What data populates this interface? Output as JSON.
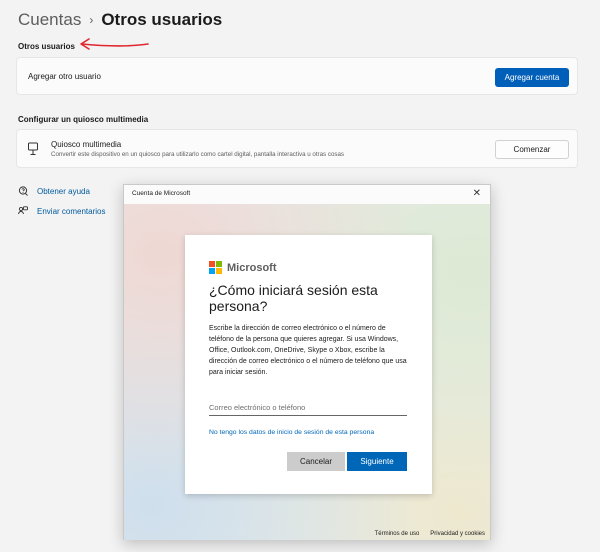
{
  "breadcrumb": {
    "parent": "Cuentas",
    "separator": "›",
    "current": "Otros usuarios"
  },
  "other_users": {
    "section_title": "Otros usuarios",
    "add_label": "Agregar otro usuario",
    "add_button": "Agregar cuenta"
  },
  "kiosk": {
    "section_title": "Configurar un quiosco multimedia",
    "title": "Quiosco multimedia",
    "description": "Convertir este dispositivo en un quiosco para utilizarlo como cartel digital, pantalla interactiva u otras cosas",
    "button": "Comenzar"
  },
  "help_links": [
    {
      "label": "Obtener ayuda",
      "icon": "help-icon"
    },
    {
      "label": "Enviar comentarios",
      "icon": "feedback-icon"
    }
  ],
  "dialog": {
    "title": "Cuenta de Microsoft",
    "close_glyph": "✕",
    "brand": "Microsoft",
    "brand_colors": [
      "#f25022",
      "#7fba00",
      "#00a4ef",
      "#ffb900"
    ],
    "heading": "¿Cómo iniciará sesión esta persona?",
    "description": "Escribe la dirección de correo electrónico o el número de teléfono de la persona que quieres agregar. Si usa Windows, Office, Outlook.com, OneDrive, Skype o Xbox, escribe la dirección de correo electrónico o el número de teléfono que usa para iniciar sesión.",
    "input_placeholder": "Correo electrónico o teléfono",
    "input_value": "",
    "no_data_link": "No tengo los datos de inicio de sesión de esta persona",
    "cancel_button": "Cancelar",
    "next_button": "Siguiente",
    "footer_links": [
      "Términos de uso",
      "Privacidad y cookies"
    ]
  },
  "colors": {
    "accent": "#005fb8",
    "ms_blue": "#0067b8",
    "annotation_arrow": "#e0262e"
  }
}
